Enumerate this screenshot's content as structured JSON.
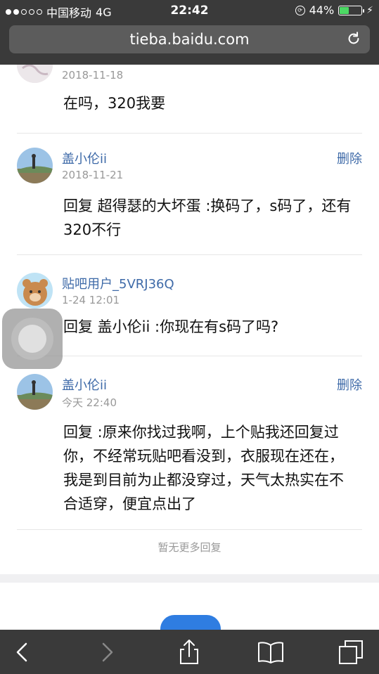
{
  "status_bar": {
    "carrier": "中国移动",
    "network": "4G",
    "time": "22:42",
    "battery_percent": "44%",
    "battery_level": 0.44,
    "battery_color": "#4cd964",
    "signal_bars_filled": 2,
    "signal_bars_total": 5
  },
  "browser": {
    "url": "tieba.baidu.com",
    "reload_icon": "reload-icon"
  },
  "posts": [
    {
      "author": "",
      "time": "2018-11-18",
      "delete_label": "",
      "text": "在吗，320我要"
    },
    {
      "author": "盖小伦ii",
      "time": "2018-11-21",
      "delete_label": "删除",
      "text": "回复 超得瑟的大坏蛋 :换码了，s码了，还有320不行"
    },
    {
      "author": "贴吧用户_5VRJ36Q",
      "time": "1-24 12:01",
      "delete_label": "",
      "text": "回复 盖小伦ii :你现在有s码了吗?"
    },
    {
      "author": "盖小伦ii",
      "time": "今天 22:40",
      "delete_label": "删除",
      "text": "回复 :原来你找过我啊，上个贴我还回复过你，不经常玩贴吧看没到，衣服现在还在，我是到目前为止都没穿过，天气太热实在不合适穿，便宜点出了"
    }
  ],
  "footer": {
    "no_more_replies": "暂无更多回复"
  },
  "colors": {
    "link_blue": "#3e6aa8",
    "chrome_dark": "#3a3a3a",
    "button_blue": "#2f7de1"
  },
  "toolbar": {
    "icons": [
      "back-icon",
      "forward-icon",
      "share-icon",
      "bookmarks-icon",
      "tabs-icon"
    ]
  }
}
